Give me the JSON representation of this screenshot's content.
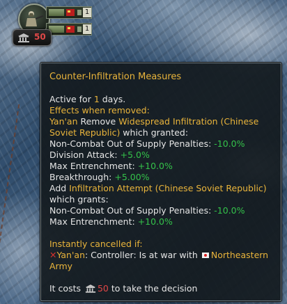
{
  "unit_panel": {
    "row1_value": "1",
    "row2_value": "1",
    "political_power": "50"
  },
  "tooltip": {
    "title": "Counter-Infiltration Measures",
    "active_prefix": "Active for ",
    "active_days": "1",
    "active_suffix": " days.",
    "effects_header": "Effects when removed:",
    "remove_actor": "Yan'an",
    "remove_verb": " Remove ",
    "remove_target": "Widespread Infiltration (Chinese",
    "remove_target2": "Soviet Republic)",
    "remove_granted": " which granted:",
    "m1_label": "Non-Combat Out of Supply Penalties: ",
    "m1_value": "-10.0%",
    "m2_label": "Division Attack: ",
    "m2_value": "+5.0%",
    "m3_label": "Max Entrenchment: ",
    "m3_value": "+10.0%",
    "m4_label": "Breakthrough: ",
    "m4_value": "+5.00%",
    "add_verb": "Add ",
    "add_target": "Infiltration Attempt (Chinese Soviet Republic)",
    "add_grants": "which grants:",
    "m5_label": "Non-Combat Out of Supply Penalties: ",
    "m5_value": "-10.0%",
    "m6_label": "Max Entrenchment: ",
    "m6_value": "+10.0%",
    "cancel_header": "Instantly cancelled if:",
    "cancel_actor": "Yan'an",
    "cancel_text": ": Controller: Is at war with ",
    "cancel_target1": "Northeastern",
    "cancel_target2": "Army",
    "cost_prefix": "It costs ",
    "cost_value": "50",
    "cost_suffix": " to take the decision"
  },
  "colors": {
    "highlight": "#e9b43b",
    "positive": "#34c24a",
    "cost": "#e14646"
  },
  "icons": [
    "soldier-icon",
    "political-power-icon",
    "cross-icon",
    "flag-icon"
  ]
}
